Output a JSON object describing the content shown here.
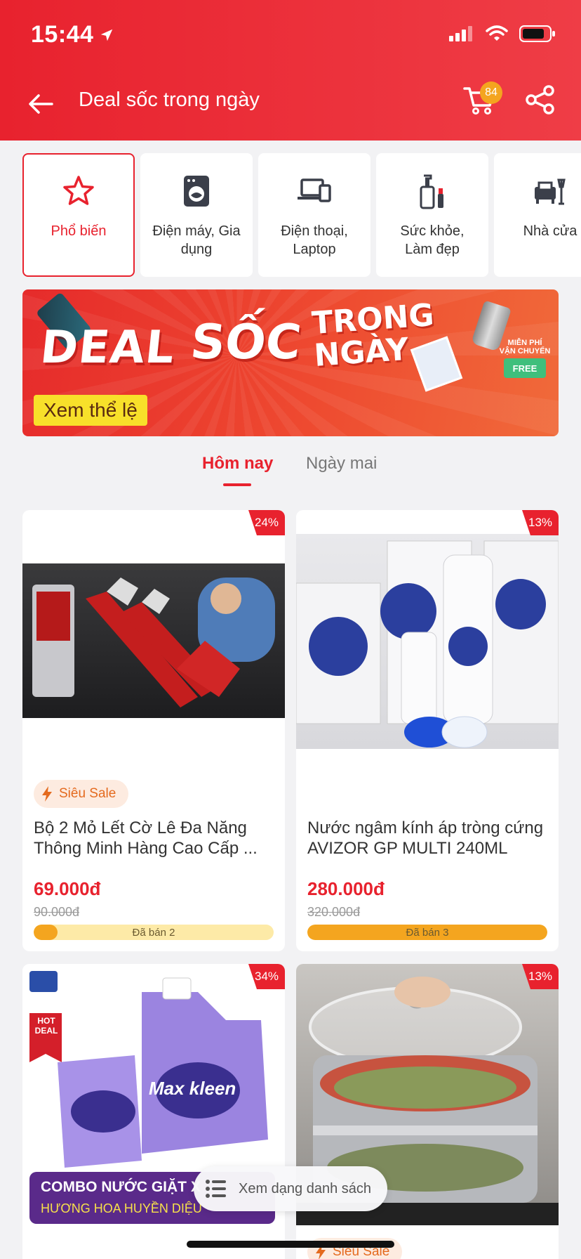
{
  "status_bar": {
    "time": "15:44"
  },
  "nav": {
    "title": "Deal sốc trong ngày",
    "cart_count": "84"
  },
  "categories": [
    {
      "label": "Phổ biến",
      "icon": "star-icon",
      "active": true
    },
    {
      "label": "Điện máy, Gia\ndụng",
      "icon": "washing-machine-icon"
    },
    {
      "label": "Điện thoại,\nLaptop",
      "icon": "laptop-phone-icon"
    },
    {
      "label": "Sức khỏe,\nLàm đẹp",
      "icon": "cosmetics-icon"
    },
    {
      "label": "Nhà cửa",
      "icon": "sofa-icon"
    }
  ],
  "banner": {
    "word_deal": "DEAL",
    "word_soc": "SỐC",
    "word_trong": "TRONG",
    "word_ngay": "NGÀY",
    "rules_button": "Xem thể lệ",
    "free_ship_line1": "MIỄN PHÍ",
    "free_ship_line2": "VẬN CHUYỂN",
    "free_label": "FREE"
  },
  "tabs": {
    "today": "Hôm nay",
    "tomorrow": "Ngày mai"
  },
  "products": [
    {
      "discount": "24%",
      "badge": "Siêu Sale",
      "name": "Bộ 2 Mỏ Lết Cờ Lê Đa Năng Thông Minh Hàng Cao Cấp ...",
      "price": "69.000đ",
      "old_price": "90.000đ",
      "sold": "Đã bán 2",
      "sold_fraction": 0.1
    },
    {
      "discount": "13%",
      "name": "Nước ngâm kính áp tròng cứng AVIZOR GP MULTI 240ML",
      "price": "280.000đ",
      "old_price": "320.000đ",
      "sold": "Đã bán 3",
      "sold_fraction": 1.0
    },
    {
      "discount": "34%",
      "img_text_1": "HOT DEAL",
      "img_text_2": "Max kleen",
      "img_text_3": "COMBO NƯỚC GIẶT X",
      "img_text_4": "HƯƠNG HOA HUYỀN DIỆU"
    },
    {
      "discount": "13%",
      "badge": "Siêu Sale"
    }
  ],
  "list_view_button": "Xem dạng danh sách",
  "colors": {
    "brand_red": "#e8222e",
    "sale_orange": "#f4a51f"
  }
}
